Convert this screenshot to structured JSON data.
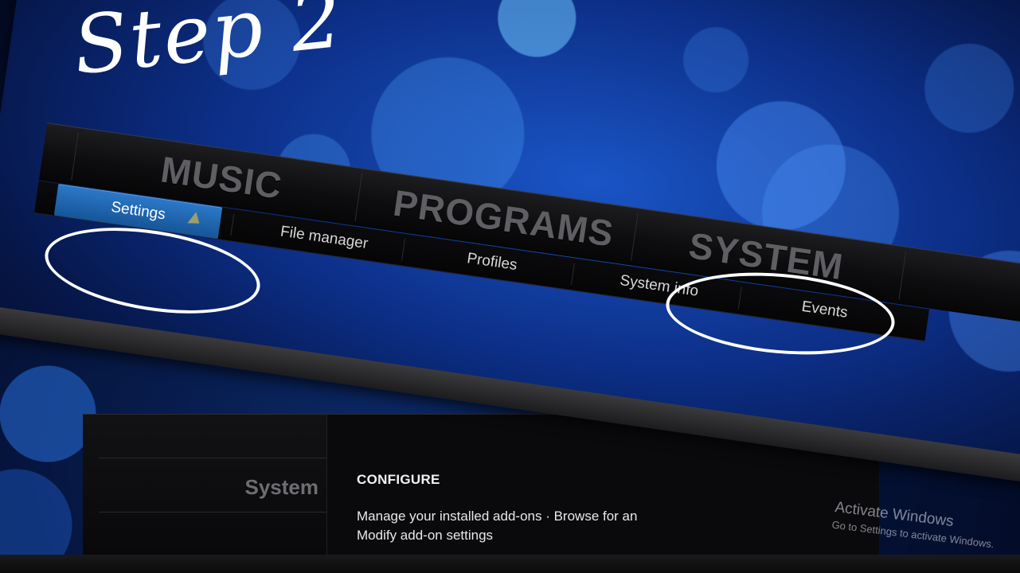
{
  "annotation": {
    "text": "Step 2"
  },
  "main_menu": {
    "items": [
      "MUSIC",
      "PROGRAMS",
      "SYSTEM"
    ]
  },
  "submenu": {
    "items": [
      "Settings",
      "File manager",
      "Profiles",
      "System info",
      "Events"
    ],
    "selected": "Settings"
  },
  "settings_panel": {
    "sidebar_title": "System",
    "section_title": "CONFIGURE",
    "description_line1": "Manage your installed add-ons · Browse for an",
    "description_line2": "Modify add-on settings"
  },
  "watermark": {
    "title": "Activate Windows",
    "subtitle": "Go to Settings to activate Windows."
  },
  "colors": {
    "accent": "#2c79c9",
    "background": "#0c2e86",
    "menu_text": "#5f5f63"
  },
  "icons": [
    "mouse-cursor-icon"
  ]
}
